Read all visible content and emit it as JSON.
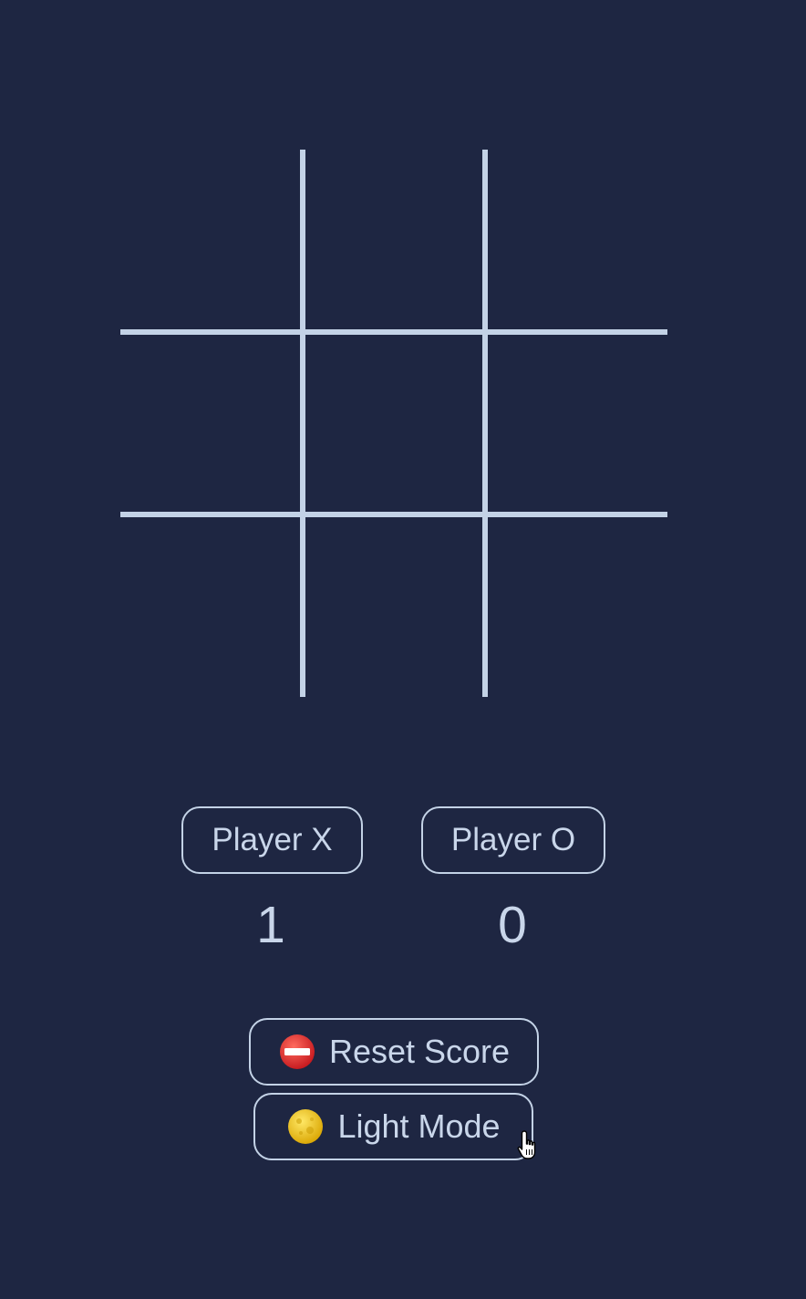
{
  "board": {
    "cells": [
      "",
      "",
      "",
      "",
      "",
      "",
      "",
      "",
      ""
    ]
  },
  "players": {
    "x": {
      "label": "Player X",
      "score": "1"
    },
    "o": {
      "label": "Player O",
      "score": "0"
    }
  },
  "actions": {
    "reset_label": "Reset Score",
    "reset_icon": "no-entry-icon",
    "mode_label": "Light Mode",
    "mode_icon": "moon-icon"
  },
  "colors": {
    "background": "#1e2642",
    "grid_lines": "#c3d2e6",
    "text": "#c9d6ea"
  }
}
